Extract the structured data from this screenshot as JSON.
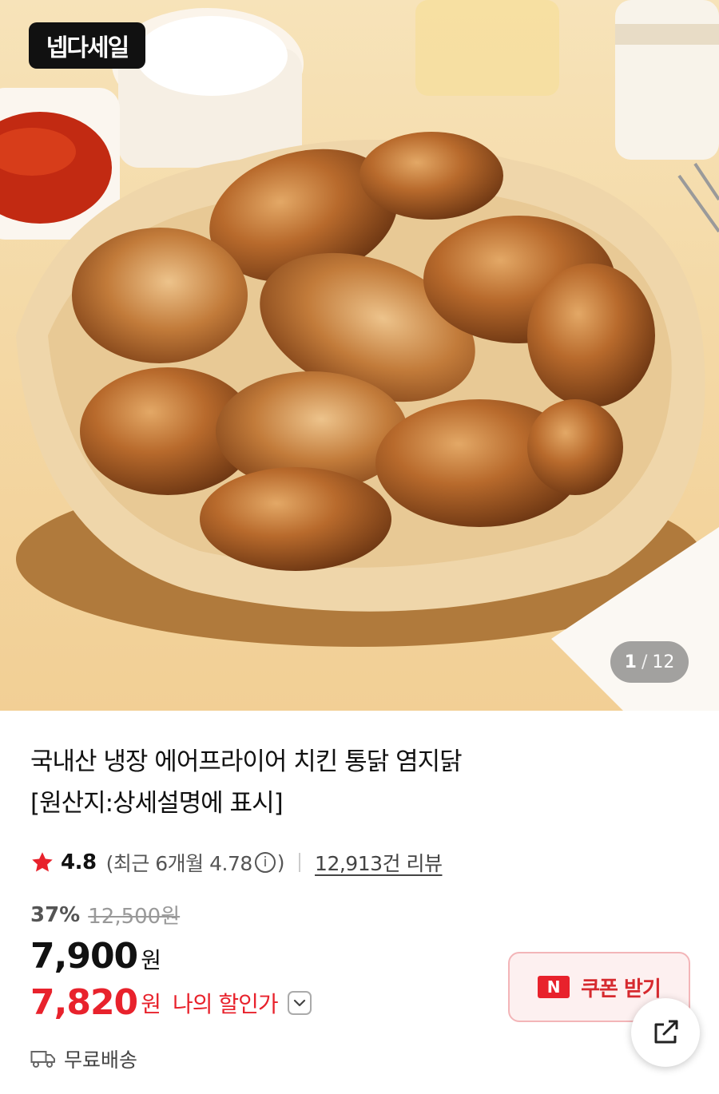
{
  "badge": {
    "label": "넵다세일"
  },
  "pager": {
    "current": "1",
    "separator": "/",
    "total": "12"
  },
  "product": {
    "title_line1": "국내산 냉장 에어프라이어 치킨 통닭 염지닭",
    "title_line2": "[원산지:상세설명에 표시]"
  },
  "rating": {
    "score": "4.8",
    "recent_prefix": "(최근 6개월 4.78",
    "recent_suffix": ")",
    "reviews": "12,913건 리뷰"
  },
  "price": {
    "discount": "37%",
    "original": "12,500원",
    "sale": "7,900",
    "sale_unit": "원",
    "my_price": "7,820",
    "my_unit": "원",
    "my_label": "나의 할인가"
  },
  "coupon": {
    "logo": "N",
    "label": "쿠폰 받기"
  },
  "shipping": {
    "label": "무료배송"
  },
  "colors": {
    "accent_red": "#e8222c",
    "coupon_bg": "#fdf0f0"
  },
  "icons": [
    "star-icon",
    "info-icon",
    "chevron-down-icon",
    "naver-n-icon",
    "share-icon",
    "truck-icon"
  ]
}
